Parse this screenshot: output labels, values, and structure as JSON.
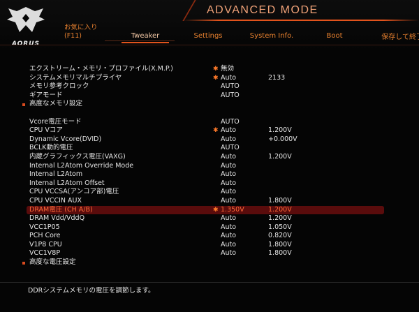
{
  "header": {
    "logo_text": "AORUS",
    "mode_title": "ADVANCED MODE",
    "favorites_label": "お気に入り",
    "favorites_key": "(F11)",
    "tabs": [
      {
        "label": "Tweaker",
        "active": true
      },
      {
        "label": "Settings",
        "active": false
      },
      {
        "label": "System Info.",
        "active": false
      },
      {
        "label": "Boot",
        "active": false
      }
    ],
    "save_label": "保存して終了"
  },
  "settings": [
    {
      "label": "エクストリーム・メモリ・プロファイル(X.M.P.)",
      "star": true,
      "v1": "無効",
      "v2": ""
    },
    {
      "label": "システムメモリマルチプライヤ",
      "star": true,
      "v1": "Auto",
      "v2": "2133"
    },
    {
      "label": "メモリ参考クロック",
      "star": false,
      "v1": "AUTO",
      "v2": ""
    },
    {
      "label": "ギアモード",
      "star": false,
      "v1": "AUTO",
      "v2": ""
    },
    {
      "label": "高度なメモリ設定",
      "star": false,
      "v1": "",
      "v2": "",
      "bullet": true
    },
    {
      "spacer": true
    },
    {
      "label": "Vcore電圧モード",
      "star": false,
      "v1": "AUTO",
      "v2": ""
    },
    {
      "label": "CPU Vコア",
      "star": true,
      "v1": "Auto",
      "v2": "1.200V"
    },
    {
      "label": "Dynamic Vcore(DVID)",
      "star": false,
      "v1": "Auto",
      "v2": "+0.000V"
    },
    {
      "label": "BCLK動的電圧",
      "star": false,
      "v1": "AUTO",
      "v2": ""
    },
    {
      "label": "内蔵グラフィックス電圧(VAXG)",
      "star": false,
      "v1": "Auto",
      "v2": "1.200V"
    },
    {
      "label": "Internal L2Atom Override Mode",
      "star": false,
      "v1": "Auto",
      "v2": ""
    },
    {
      "label": "Internal L2Atom",
      "star": false,
      "v1": "Auto",
      "v2": ""
    },
    {
      "label": "Internal L2Atom Offset",
      "star": false,
      "v1": "Auto",
      "v2": ""
    },
    {
      "label": "CPU VCCSA(アンコア部)電圧",
      "star": false,
      "v1": "Auto",
      "v2": ""
    },
    {
      "label": "CPU VCCIN AUX",
      "star": false,
      "v1": "Auto",
      "v2": "1.800V"
    },
    {
      "label": "DRAM電圧 (CH A/B)",
      "star": true,
      "v1": "1.350V",
      "v2": "1.200V",
      "highlight": true
    },
    {
      "label": "DRAM Vdd/VddQ",
      "star": false,
      "v1": "Auto",
      "v2": "1.200V"
    },
    {
      "label": "VCC1P05",
      "star": false,
      "v1": "Auto",
      "v2": "1.050V"
    },
    {
      "label": "PCH Core",
      "star": false,
      "v1": "Auto",
      "v2": "0.820V"
    },
    {
      "label": "V1P8 CPU",
      "star": false,
      "v1": "Auto",
      "v2": "1.800V"
    },
    {
      "label": "VCC1V8P",
      "star": false,
      "v1": "Auto",
      "v2": "1.800V"
    },
    {
      "label": "高度な電圧設定",
      "star": false,
      "v1": "",
      "v2": "",
      "bullet": true
    }
  ],
  "status_text": "DDRシステムメモリの電圧を調節します。"
}
